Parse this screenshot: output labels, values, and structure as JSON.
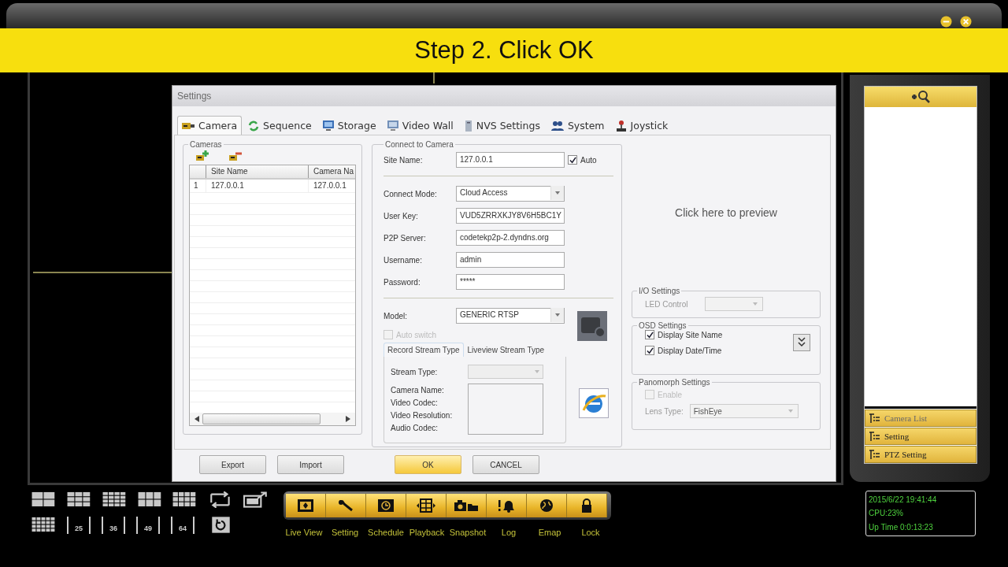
{
  "banner": {
    "text": "Step 2. Click OK"
  },
  "dialog": {
    "title": "Settings",
    "tabs": [
      {
        "label": "Camera",
        "selected": true
      },
      {
        "label": "Sequence",
        "selected": false
      },
      {
        "label": "Storage",
        "selected": false
      },
      {
        "label": "Video Wall",
        "selected": false
      },
      {
        "label": "NVS Settings",
        "selected": false
      },
      {
        "label": "System",
        "selected": false
      },
      {
        "label": "Joystick",
        "selected": false
      }
    ],
    "cameras": {
      "title": "Cameras",
      "columns": [
        "Site Name",
        "Camera Na"
      ],
      "rows": [
        {
          "index": "1",
          "cells": [
            "127.0.0.1",
            "127.0.0.1"
          ]
        }
      ]
    },
    "connect": {
      "title": "Connect to Camera",
      "site_name": {
        "label": "Site Name:",
        "value": "127.0.0.1"
      },
      "auto": {
        "label": "Auto",
        "checked": true
      },
      "fields": [
        {
          "label": "Connect Mode:",
          "value": "Cloud Access",
          "kind": "dropdown"
        },
        {
          "label": "User Key:",
          "value": "VUD5ZRRXKJY8V6H5BC1Y",
          "kind": "text"
        },
        {
          "label": "P2P Server:",
          "value": "codetekp2p-2.dyndns.org",
          "kind": "text"
        },
        {
          "label": "Username:",
          "value": "admin",
          "kind": "text"
        },
        {
          "label": "Password:",
          "value": "*****",
          "kind": "text"
        }
      ],
      "model": {
        "label": "Model:",
        "value": "GENERIC RTSP"
      },
      "auto_switch": {
        "label": "Auto switch",
        "checked": false,
        "disabled": true
      },
      "stream_tabs": [
        {
          "label": "Record Stream Type",
          "selected": true
        },
        {
          "label": "Liveview Stream Type",
          "selected": false
        }
      ],
      "stream_fields": [
        {
          "label": "Stream Type:",
          "kind": "dropdown"
        },
        {
          "label": "Camera Name:",
          "kind": "text"
        },
        {
          "label": "Video Codec:",
          "kind": "text"
        },
        {
          "label": "Video Resolution:",
          "kind": "text"
        },
        {
          "label": "Audio Codec:",
          "kind": "text"
        }
      ]
    },
    "preview": {
      "text": "Click here to preview"
    },
    "io": {
      "title": "I/O Settings",
      "led_label": "LED Control"
    },
    "osd": {
      "title": "OSD Settings",
      "options": [
        {
          "label": "Display Site Name",
          "checked": true
        },
        {
          "label": "Display Date/Time",
          "checked": true
        }
      ]
    },
    "panomorph": {
      "title": "Panomorph Settings",
      "enable": {
        "label": "Enable",
        "checked": false,
        "disabled": true
      },
      "lens_label": "Lens Type:",
      "lens_value": "FishEye"
    },
    "buttons": [
      {
        "label": "Export",
        "kind": "plain"
      },
      {
        "label": "Import",
        "kind": "plain"
      },
      {
        "label": "OK",
        "kind": "primary"
      },
      {
        "label": "CANCEL",
        "kind": "plain"
      }
    ]
  },
  "layout_counts": [
    "25",
    "36",
    "49",
    "64"
  ],
  "toolbar": [
    {
      "label": "Live View"
    },
    {
      "label": "Setting"
    },
    {
      "label": "Schedule"
    },
    {
      "label": "Playback"
    },
    {
      "label": "Snapshot"
    },
    {
      "label": "Log"
    },
    {
      "label": "Emap"
    },
    {
      "label": "Lock"
    }
  ],
  "side_panel": {
    "items": [
      "Camera List",
      "Setting",
      "PTZ Setting"
    ]
  },
  "status": [
    "2015/6/22 19:41:44",
    "CPU:23%",
    "Up Time 0:0:13:23"
  ]
}
